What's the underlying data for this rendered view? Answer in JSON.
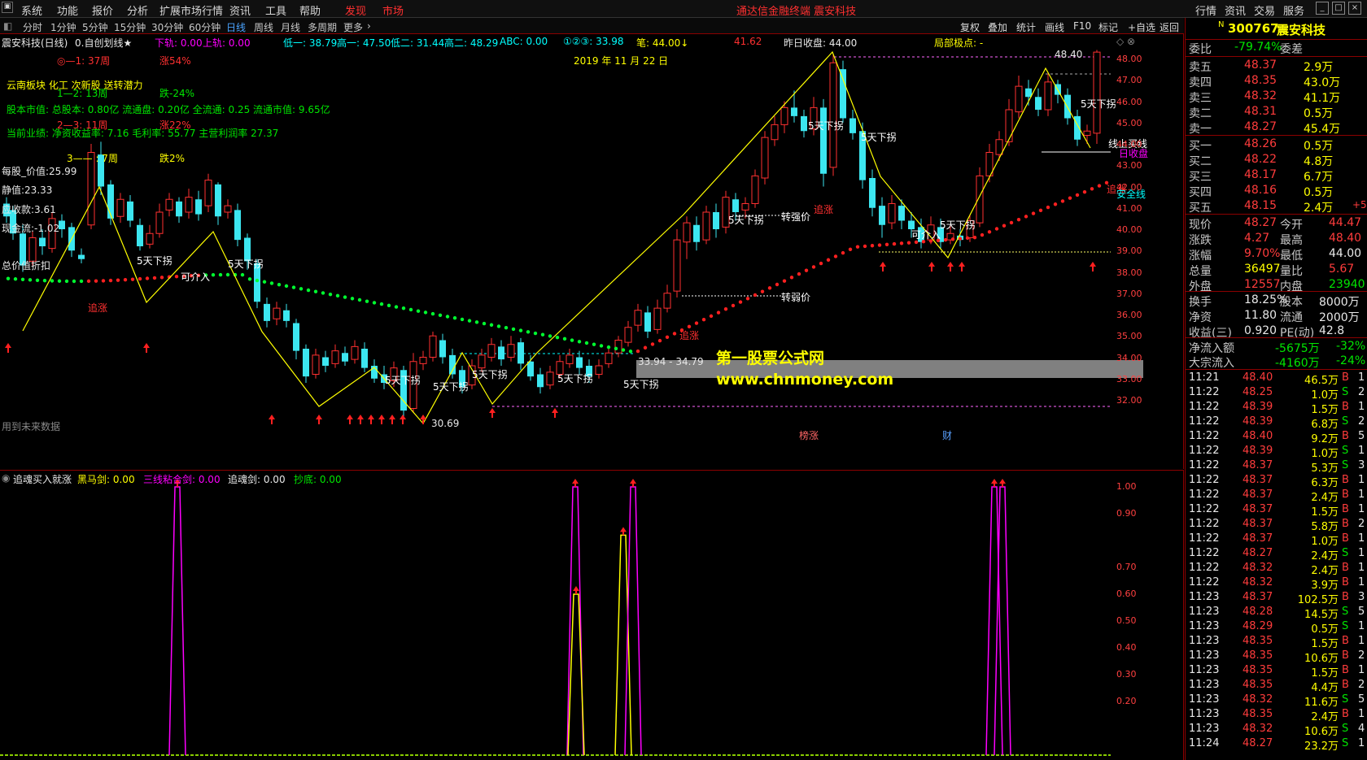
{
  "menu": {
    "items": [
      "系统",
      "功能",
      "报价",
      "分析",
      "扩展市场行情",
      "资讯",
      "工具",
      "帮助"
    ],
    "highlight": [
      "发现",
      "市场"
    ],
    "title": "通达信金融终端 震安科技",
    "right": [
      "行情",
      "资讯",
      "交易",
      "服务"
    ]
  },
  "periods": {
    "items": [
      "分时",
      "1分钟",
      "5分钟",
      "15分钟",
      "30分钟",
      "60分钟",
      "日线",
      "周线",
      "月线",
      "多周期",
      "更多"
    ],
    "active": "日线",
    "tools": [
      "复权",
      "叠加",
      "统计",
      "画线",
      "F10",
      "标记",
      "+自选",
      "返回"
    ]
  },
  "main": {
    "title": "震安科技(日线)",
    "formula": "0.自创划线★",
    "header_items": [
      "下轨: 0.00",
      "上轨: 0.00",
      "低一: 38.79",
      "高一: 47.50",
      "低二: 31.44",
      "高二: 48.29",
      "ABC: 0.00",
      "①②③: 33.98",
      "笔: 44.00↓",
      "41.62",
      "昨日收盘: 44.00",
      "局部极点: -"
    ],
    "date_label": "2019 年 11 月 22 日",
    "info_lines": [
      {
        "text": "◎—1:  37周",
        "color": "#ff3030"
      },
      {
        "text": "涨54%",
        "color": "#ff3030"
      },
      {
        "text": "云南板块 化工 次新股 送转潜力",
        "color": "#ffff00"
      },
      {
        "text": "1—2:  13周",
        "color": "#00e600"
      },
      {
        "text": "跌-24%",
        "color": "#00e600"
      },
      {
        "text": "股本市值: 总股本: 0.80亿 流通盘: 0.20亿 全流通: 0.25 流通市值: 9.65亿",
        "color": "#00e600"
      },
      {
        "text": "2—3:  11周",
        "color": "#ff3030"
      },
      {
        "text": "涨22%",
        "color": "#ff3030"
      },
      {
        "text": "当前业绩: 净资收益率: 7.16 毛利率: 55.77 主营利润率 27.37",
        "color": "#00e600"
      },
      {
        "text": "3—— :  7周",
        "color": "#ffff00"
      },
      {
        "text": "跌2%",
        "color": "#ffff00"
      }
    ],
    "left_values": [
      "每股_价值:25.99",
      "静值:23.33",
      "应收款:3.61",
      "现金流:-1.02",
      "总价值折扣"
    ],
    "future_note": "用到未来数据",
    "watermark1": "第一股票公式网",
    "watermark2": "www.chnmoney.com",
    "annotations": {
      "down5": "5天下拐",
      "zhuizhang": "追涨",
      "kexiru": "可介入",
      "qiang": "转强价",
      "ruo": "转弱价",
      "range": "33.94 - 34.79",
      "low": "30.69",
      "high": "48.40",
      "safe": "安全线",
      "buyline": "线上买线",
      "prevclose": "日收盘",
      "bangzhang": "榜涨",
      "cai": "财"
    },
    "y_ticks": [
      "48.00",
      "47.00",
      "46.00",
      "45.00",
      "44.00",
      "43.00",
      "42.00",
      "41.00",
      "40.00",
      "39.00",
      "38.00",
      "37.00",
      "36.00",
      "35.00",
      "34.00",
      "33.00",
      "32.00"
    ]
  },
  "sub": {
    "title": "追魂买入就涨",
    "items": [
      {
        "text": "黑马剑: 0.00",
        "color": "#ffff00"
      },
      {
        "text": "三线粘合剑: 0.00",
        "color": "#ff00ff"
      },
      {
        "text": "追魂剑: 0.00",
        "color": "#e8e8e8"
      },
      {
        "text": "抄底: 0.00",
        "color": "#00e600"
      }
    ],
    "y_ticks": [
      "1.00",
      "0.90",
      "0.70",
      "0.60",
      "0.50",
      "0.40",
      "0.30",
      "0.20"
    ]
  },
  "quote": {
    "code": "300767",
    "name": "震安科技",
    "weibi_label": "委比",
    "weibi": "-79.74%",
    "weicha_label": "委差",
    "asks": [
      {
        "label": "卖五",
        "price": "48.37",
        "vol": "2.9万"
      },
      {
        "label": "卖四",
        "price": "48.35",
        "vol": "43.0万"
      },
      {
        "label": "卖三",
        "price": "48.32",
        "vol": "41.1万"
      },
      {
        "label": "卖二",
        "price": "48.31",
        "vol": "0.5万"
      },
      {
        "label": "卖一",
        "price": "48.27",
        "vol": "45.4万"
      }
    ],
    "bids": [
      {
        "label": "买一",
        "price": "48.26",
        "vol": "0.5万"
      },
      {
        "label": "买二",
        "price": "48.22",
        "vol": "4.8万"
      },
      {
        "label": "买三",
        "price": "48.17",
        "vol": "6.7万"
      },
      {
        "label": "买四",
        "price": "48.16",
        "vol": "0.5万"
      },
      {
        "label": "买五",
        "price": "48.15",
        "vol": "2.4万",
        "extra": "+5"
      }
    ],
    "stats": [
      {
        "l1": "现价",
        "v1": "48.27",
        "c1": "red",
        "l2": "今开",
        "v2": "44.47",
        "c2": "red"
      },
      {
        "l1": "涨跌",
        "v1": "4.27",
        "c1": "red",
        "l2": "最高",
        "v2": "48.40",
        "c2": "red"
      },
      {
        "l1": "涨幅",
        "v1": "9.70%",
        "c1": "red",
        "l2": "最低",
        "v2": "44.00",
        "c2": "white"
      },
      {
        "l1": "总量",
        "v1": "36497",
        "c1": "yellow",
        "l2": "量比",
        "v2": "5.67",
        "c2": "red"
      },
      {
        "l1": "外盘",
        "v1": "12557",
        "c1": "red",
        "l2": "内盘",
        "v2": "23940",
        "c2": "green"
      }
    ],
    "stats2": [
      {
        "l1": "换手",
        "v1": "18.25%",
        "l2": "股本",
        "v2": "8000万"
      },
      {
        "l1": "净资",
        "v1": "11.80",
        "l2": "流通",
        "v2": "2000万"
      },
      {
        "l1": "收益(三)",
        "v1": "0.920",
        "l2": "PE(动)",
        "v2": "42.8"
      }
    ],
    "flows": [
      {
        "label": "净流入额",
        "value": "-5675万",
        "pct": "-32%"
      },
      {
        "label": "大宗流入",
        "value": "-4160万",
        "pct": "-24%"
      }
    ],
    "ticks": [
      {
        "t": "11:21",
        "p": "48.40",
        "v": "46.5万",
        "d": "B",
        "n": "1"
      },
      {
        "t": "11:22",
        "p": "48.25",
        "v": "1.0万",
        "d": "S",
        "n": "2"
      },
      {
        "t": "11:22",
        "p": "48.39",
        "v": "1.5万",
        "d": "B",
        "n": "1"
      },
      {
        "t": "11:22",
        "p": "48.39",
        "v": "6.8万",
        "d": "S",
        "n": "2"
      },
      {
        "t": "11:22",
        "p": "48.40",
        "v": "9.2万",
        "d": "B",
        "n": "5"
      },
      {
        "t": "11:22",
        "p": "48.39",
        "v": "1.0万",
        "d": "S",
        "n": "1"
      },
      {
        "t": "11:22",
        "p": "48.37",
        "v": "5.3万",
        "d": "S",
        "n": "3"
      },
      {
        "t": "11:22",
        "p": "48.37",
        "v": "6.3万",
        "d": "B",
        "n": "1"
      },
      {
        "t": "11:22",
        "p": "48.37",
        "v": "2.4万",
        "d": "B",
        "n": "1"
      },
      {
        "t": "11:22",
        "p": "48.37",
        "v": "1.5万",
        "d": "B",
        "n": "1"
      },
      {
        "t": "11:22",
        "p": "48.37",
        "v": "5.8万",
        "d": "B",
        "n": "2"
      },
      {
        "t": "11:22",
        "p": "48.37",
        "v": "1.0万",
        "d": "B",
        "n": "1"
      },
      {
        "t": "11:22",
        "p": "48.27",
        "v": "2.4万",
        "d": "S",
        "n": "1"
      },
      {
        "t": "11:22",
        "p": "48.32",
        "v": "2.4万",
        "d": "B",
        "n": "1"
      },
      {
        "t": "11:22",
        "p": "48.32",
        "v": "3.9万",
        "d": "B",
        "n": "1"
      },
      {
        "t": "11:23",
        "p": "48.37",
        "v": "102.5万",
        "d": "B",
        "n": "3"
      },
      {
        "t": "11:23",
        "p": "48.28",
        "v": "14.5万",
        "d": "S",
        "n": "5"
      },
      {
        "t": "11:23",
        "p": "48.29",
        "v": "0.5万",
        "d": "S",
        "n": "1"
      },
      {
        "t": "11:23",
        "p": "48.35",
        "v": "1.5万",
        "d": "B",
        "n": "1"
      },
      {
        "t": "11:23",
        "p": "48.35",
        "v": "10.6万",
        "d": "B",
        "n": "2"
      },
      {
        "t": "11:23",
        "p": "48.35",
        "v": "1.5万",
        "d": "B",
        "n": "1"
      },
      {
        "t": "11:23",
        "p": "48.35",
        "v": "4.4万",
        "d": "B",
        "n": "2"
      },
      {
        "t": "11:23",
        "p": "48.32",
        "v": "11.6万",
        "d": "S",
        "n": "5"
      },
      {
        "t": "11:23",
        "p": "48.35",
        "v": "2.4万",
        "d": "B",
        "n": "1"
      },
      {
        "t": "11:23",
        "p": "48.32",
        "v": "10.6万",
        "d": "S",
        "n": "4"
      },
      {
        "t": "11:24",
        "p": "48.27",
        "v": "23.2万",
        "d": "S",
        "n": "1"
      }
    ]
  },
  "colors": {
    "up": "#ff3030",
    "down": "#3ce6f0",
    "bg": "#000000",
    "border": "#8b0000",
    "zigzag": "#ffff00"
  }
}
